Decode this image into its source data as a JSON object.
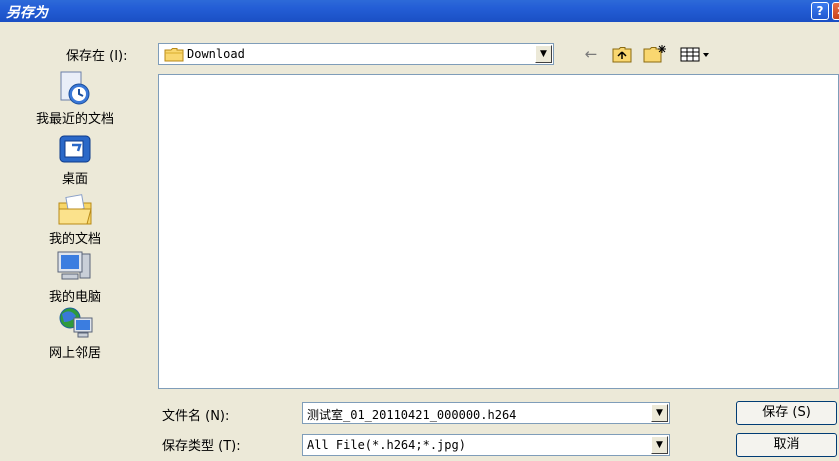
{
  "window": {
    "title": "另存为",
    "help_glyph": "?",
    "close_glyph": "✕"
  },
  "save_in": {
    "label": "保存在 (I):",
    "value": "Download"
  },
  "toolbar": {
    "back_glyph": "←",
    "up_folder_glyph": "⬒",
    "new_folder_glyph": "✱",
    "view_menu_glyph": "▦▾"
  },
  "places": [
    {
      "label": "我最近的文档",
      "icon": "recent-documents-icon"
    },
    {
      "label": "桌面",
      "icon": "desktop-icon"
    },
    {
      "label": "我的文档",
      "icon": "my-documents-icon"
    },
    {
      "label": "我的电脑",
      "icon": "my-computer-icon"
    },
    {
      "label": "网上邻居",
      "icon": "network-places-icon"
    }
  ],
  "filename": {
    "label": "文件名 (N):",
    "value": "测试室_01_20110421_000000.h264"
  },
  "filetype": {
    "label": "保存类型 (T):",
    "value": "All File(*.h264;*.jpg)"
  },
  "buttons": {
    "save": "保存 (S)",
    "cancel": "取消"
  },
  "colors": {
    "titlebar": "#245ed6",
    "dialog_bg": "#ece9d8",
    "field_border": "#7f9db9"
  }
}
